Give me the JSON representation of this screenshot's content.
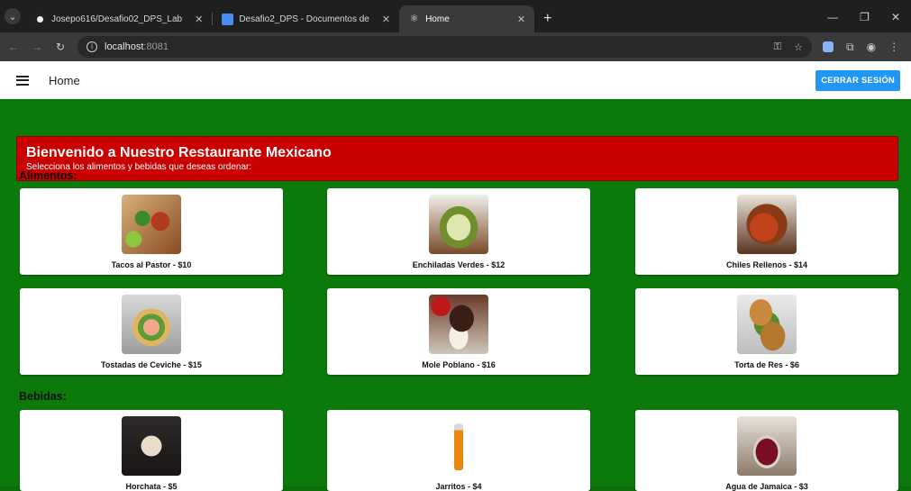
{
  "browser": {
    "tabs": [
      {
        "title": "Josepo616/Desafio02_DPS_Lab",
        "icon": "github-icon"
      },
      {
        "title": "Desafio2_DPS - Documentos de",
        "icon": "docs-icon"
      },
      {
        "title": "Home",
        "icon": "react-icon",
        "active": true
      }
    ],
    "url_host": "localhost",
    "url_port": ":8081"
  },
  "appbar": {
    "title": "Home",
    "logout_label": "CERRAR SESIÓN"
  },
  "banner": {
    "title": "Bienvenido a Nuestro Restaurante Mexicano",
    "subtitle": "Selecciona los alimentos y bebidas que deseas ordenar:"
  },
  "foods": {
    "heading": "Alimentos:",
    "items": [
      {
        "label": "Tacos al Pastor - $10",
        "image": "tacos"
      },
      {
        "label": "Enchiladas Verdes - $12",
        "image": "enchiladas"
      },
      {
        "label": "Chiles Rellenos - $14",
        "image": "chiles"
      },
      {
        "label": "Tostadas de Ceviche - $15",
        "image": "tostadas"
      },
      {
        "label": "Mole Poblano - $16",
        "image": "mole"
      },
      {
        "label": "Torta de Res - $6",
        "image": "torta"
      }
    ]
  },
  "drinks": {
    "heading": "Bebidas:",
    "items": [
      {
        "label": "Horchata - $5",
        "image": "horchata"
      },
      {
        "label": "Jarritos - $4",
        "image": "jarritos"
      },
      {
        "label": "Agua de Jamaica - $3",
        "image": "jamaica"
      }
    ]
  },
  "colors": {
    "background": "#0b7a0b",
    "banner": "#c80000",
    "button": "#2196f3"
  }
}
